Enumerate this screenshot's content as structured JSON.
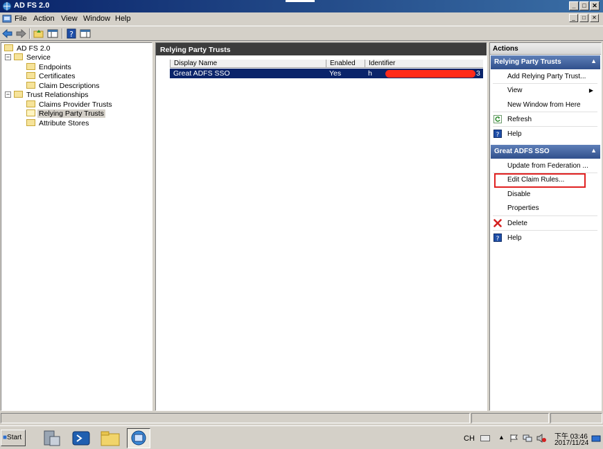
{
  "window": {
    "title": "AD FS 2.0",
    "min_glyph": "_",
    "max_glyph": "□",
    "close_glyph": "✕"
  },
  "menu": {
    "items": [
      "File",
      "Action",
      "View",
      "Window",
      "Help"
    ]
  },
  "tree": {
    "root": "AD FS 2.0",
    "service": "Service",
    "endpoints": "Endpoints",
    "certificates": "Certificates",
    "claim_descriptions": "Claim Descriptions",
    "trust_relationships": "Trust Relationships",
    "claims_provider_trusts": "Claims Provider Trusts",
    "relying_party_trusts": "Relying Party Trusts",
    "attribute_stores": "Attribute Stores",
    "collapse_glyph": "−"
  },
  "center": {
    "title": "Relying Party Trusts",
    "columns": [
      "Display Name",
      "Enabled",
      "Identifier"
    ],
    "rows": [
      {
        "display_name": "Great ADFS SSO",
        "enabled": "Yes",
        "identifier_start": "h",
        "identifier_end": "3"
      }
    ]
  },
  "actions": {
    "header": "Actions",
    "section1": {
      "title": "Relying Party Trusts",
      "items": [
        "Add Relying Party Trust...",
        "View",
        "New Window from Here",
        "Refresh",
        "Help"
      ]
    },
    "section2": {
      "title": "Great ADFS SSO",
      "items": [
        "Update from Federation ...",
        "Edit Claim Rules...",
        "Disable",
        "Properties",
        "Delete",
        "Help"
      ]
    },
    "collapse_glyph": "▲",
    "submenu_glyph": "▶"
  },
  "taskbar": {
    "start_label": "Start",
    "lang": "CH",
    "time": "下午 03:46",
    "date": "2017/11/24"
  },
  "colors": {
    "title_bar": "#0a246a",
    "selection": "#0a246a",
    "section_header": "#30508c",
    "highlight_box": "#e02020",
    "redaction": "#ff2a1a"
  }
}
